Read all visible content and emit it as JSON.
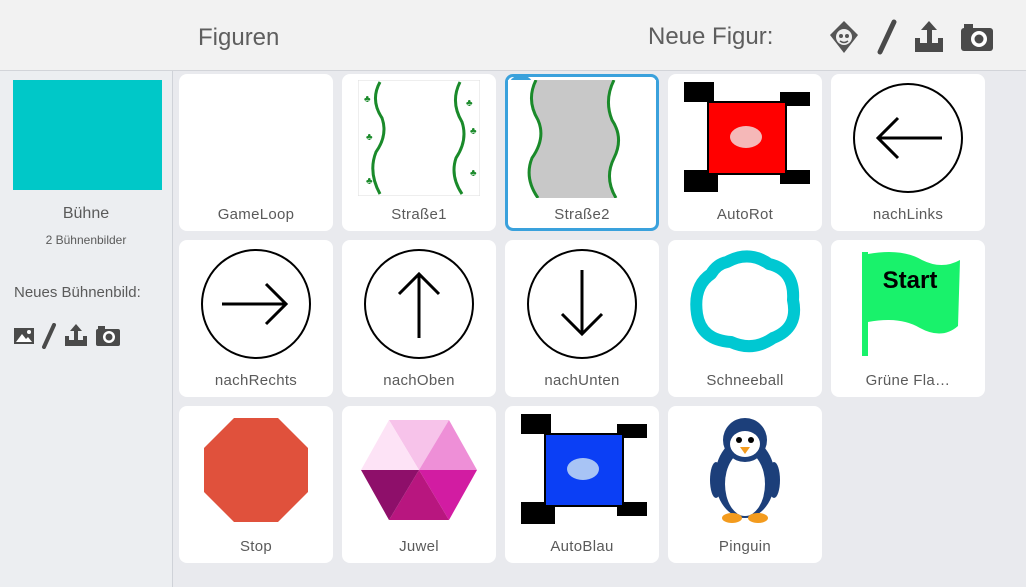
{
  "header": {
    "title": "Figuren",
    "new_sprite_label": "Neue Figur:",
    "tools": [
      "sprite-library-icon",
      "paint-brush-icon",
      "upload-icon",
      "camera-icon"
    ]
  },
  "stage": {
    "name": "Bühne",
    "backdrop_count": "2 Bühnenbilder",
    "new_backdrop_label": "Neues Bühnenbild:",
    "color": "#00c8c8",
    "tools": [
      "backdrop-library-icon",
      "paint-brush-icon",
      "upload-icon",
      "camera-icon"
    ]
  },
  "sprites": [
    {
      "label": "GameLoop",
      "icon": "blank"
    },
    {
      "label": "Straße1",
      "icon": "road-icon"
    },
    {
      "label": "Straße2",
      "icon": "road-gray-icon",
      "selected": true,
      "info": "i"
    },
    {
      "label": "AutoRot",
      "icon": "red-car-icon"
    },
    {
      "label": "nachLinks",
      "icon": "arrow-left-icon"
    },
    {
      "label": "nachRechts",
      "icon": "arrow-right-icon"
    },
    {
      "label": "nachOben",
      "icon": "arrow-up-icon"
    },
    {
      "label": "nachUnten",
      "icon": "arrow-down-icon"
    },
    {
      "label": "Schneeball",
      "icon": "snowball-icon"
    },
    {
      "label": "Grüne Fla…",
      "icon": "green-flag-icon",
      "flag_text": "Start"
    },
    {
      "label": "Stop",
      "icon": "stop-octagon-icon"
    },
    {
      "label": "Juwel",
      "icon": "jewel-icon"
    },
    {
      "label": "AutoBlau",
      "icon": "blue-car-icon"
    },
    {
      "label": "Pinguin",
      "icon": "penguin-icon"
    }
  ],
  "colors": {
    "selection": "#3aa1dc",
    "stage": "#00c8c8",
    "red_car": "#ff0000",
    "blue_car": "#0b3ff5",
    "snowball": "#00c8d2",
    "flag": "#19f26b",
    "stop": "#e0513c"
  }
}
